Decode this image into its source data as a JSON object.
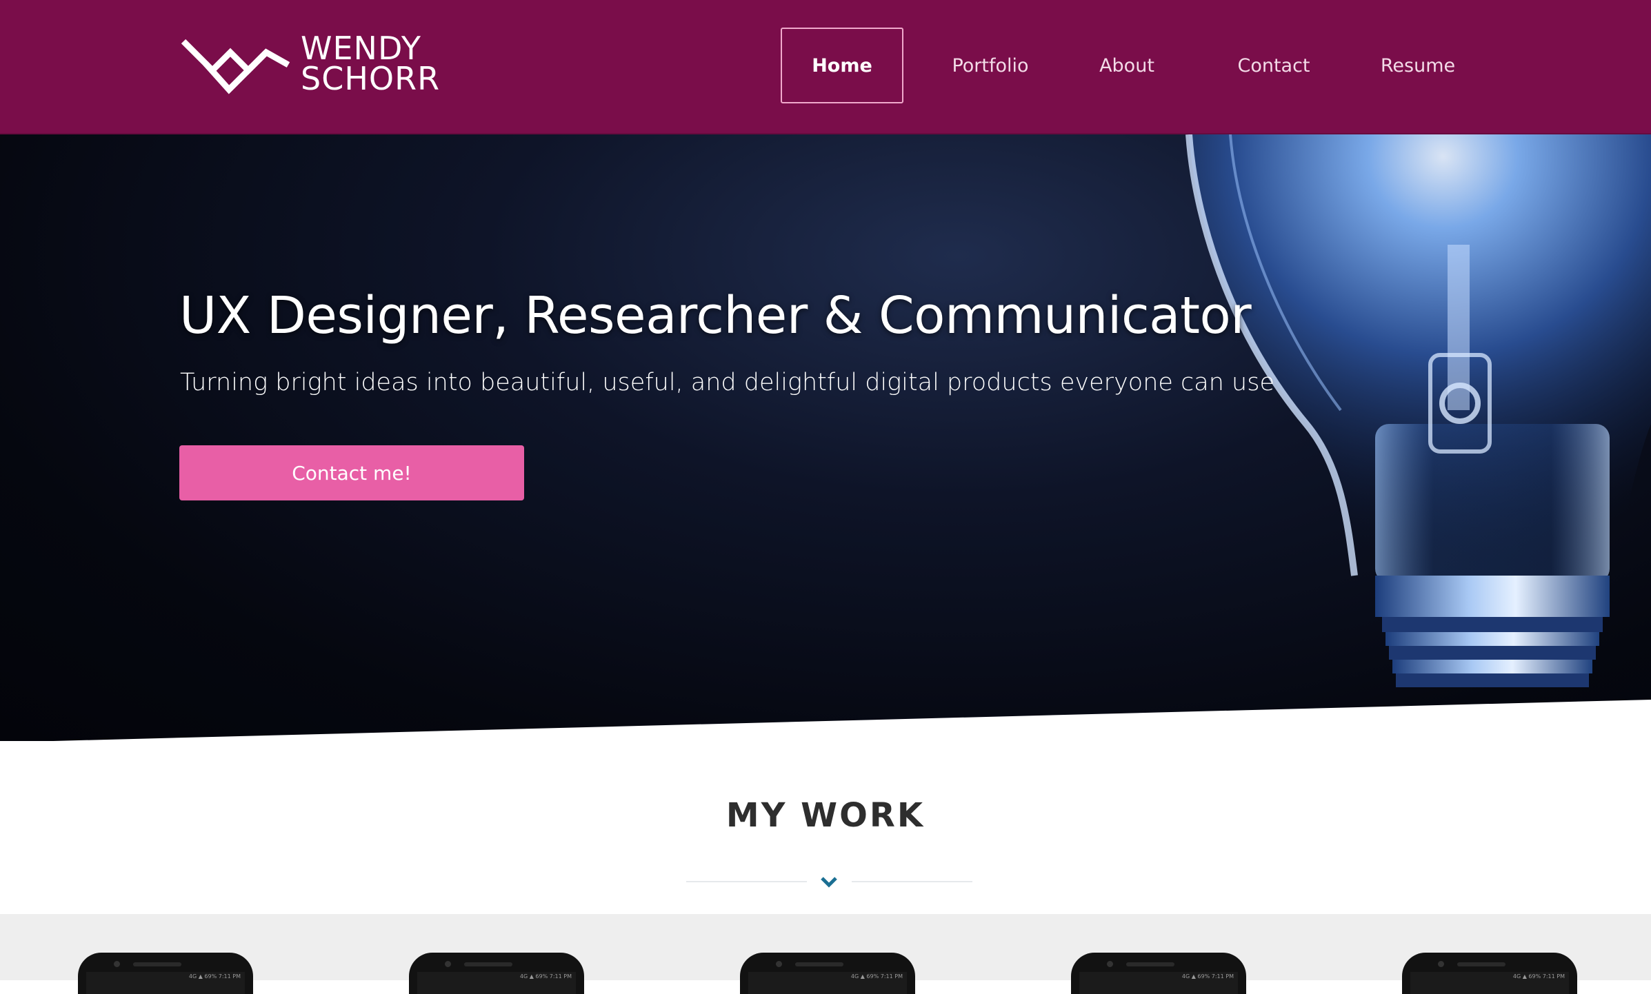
{
  "header": {
    "logo": {
      "line1": "WENDY",
      "line2": "SCHORR"
    },
    "nav": [
      {
        "label": "Home",
        "active": true
      },
      {
        "label": "Portfolio",
        "active": false
      },
      {
        "label": "About",
        "active": false
      },
      {
        "label": "Contact",
        "active": false
      },
      {
        "label": "Resume",
        "active": false
      }
    ]
  },
  "hero": {
    "title": "UX Designer, Researcher & Communicator",
    "subtitle": "Turning bright ideas into beautiful, useful, and delightful digital products everyone can use",
    "cta_label": "Contact me!"
  },
  "work": {
    "title": "MY WORK",
    "divider_icon": "chevron-down-icon",
    "cards": [
      {
        "status": "4G ▲ 69% 7:11 PM"
      },
      {
        "status": "4G ▲ 69% 7:11 PM"
      },
      {
        "status": "4G ▲ 69% 7:11 PM"
      },
      {
        "status": "4G ▲ 69% 7:11 PM"
      },
      {
        "status": "4G ▲ 69% 7:11 PM"
      }
    ]
  },
  "colors": {
    "header_bg": "#7a0d4a",
    "cta_bg": "#e85fa6",
    "hero_bg": "#05070f",
    "accent_chevron": "#1b6f93",
    "strip_bg": "#eeeeee"
  }
}
